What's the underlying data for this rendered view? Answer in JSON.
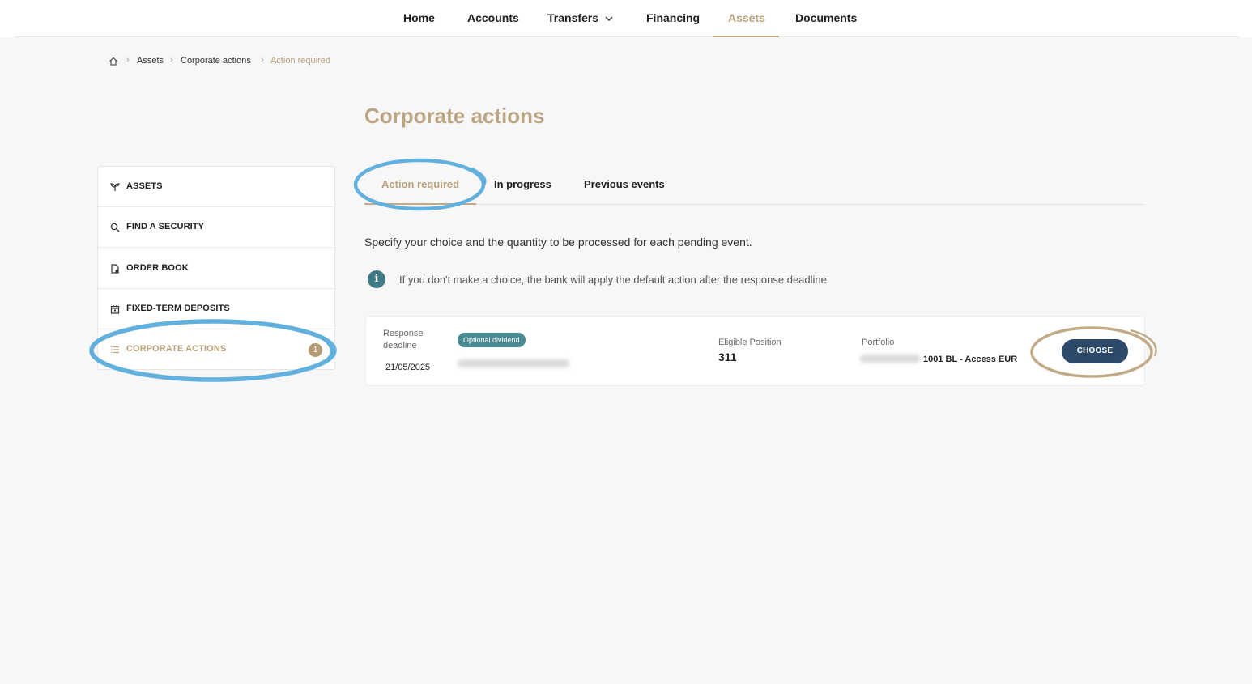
{
  "nav": {
    "items": [
      {
        "label": "Home",
        "active": false
      },
      {
        "label": "Accounts",
        "active": false
      },
      {
        "label": "Transfers",
        "active": false,
        "has_dropdown": true
      },
      {
        "label": "Financing",
        "active": false
      },
      {
        "label": "Assets",
        "active": true
      },
      {
        "label": "Documents",
        "active": false
      }
    ]
  },
  "breadcrumb": {
    "items": [
      "Assets",
      "Corporate actions",
      "Action required"
    ],
    "separator": "›",
    "home_icon": "home-icon"
  },
  "page": {
    "title": "Corporate actions",
    "instruction": "Specify your choice and the quantity to be processed for each pending event.",
    "info_text": "If you don't make a choice, the bank will apply the default action after the response deadline.",
    "info_icon": "info-icon"
  },
  "sidebar": {
    "items": [
      {
        "label": "ASSETS",
        "icon": "sprout-icon",
        "active": false
      },
      {
        "label": "FIND A SECURITY",
        "icon": "search-icon",
        "active": false
      },
      {
        "label": "ORDER BOOK",
        "icon": "document-icon",
        "active": false
      },
      {
        "label": "FIXED-TERM DEPOSITS",
        "icon": "calendar-icon",
        "active": false
      },
      {
        "label": "CORPORATE ACTIONS",
        "icon": "list-icon",
        "active": true,
        "badge": "1"
      }
    ]
  },
  "tabs": [
    {
      "label": "Action required",
      "active": true
    },
    {
      "label": "In progress",
      "active": false
    },
    {
      "label": "Previous events",
      "active": false
    }
  ],
  "event": {
    "deadline_label_line1": "Response",
    "deadline_label_line2": "deadline",
    "deadline": "21/05/2025",
    "tag": "Optional dividend",
    "position_label": "Eligible Position",
    "position": "311",
    "portfolio_label": "Portfolio",
    "portfolio": "1001 BL - Access EUR",
    "choose_label": "CHOOSE"
  },
  "colors": {
    "accent": "#b9a17c",
    "button": "#2e4a6a",
    "tag": "#4a8a93",
    "annotation_blue": "#62b0dd",
    "annotation_tan": "#c2aa86"
  }
}
